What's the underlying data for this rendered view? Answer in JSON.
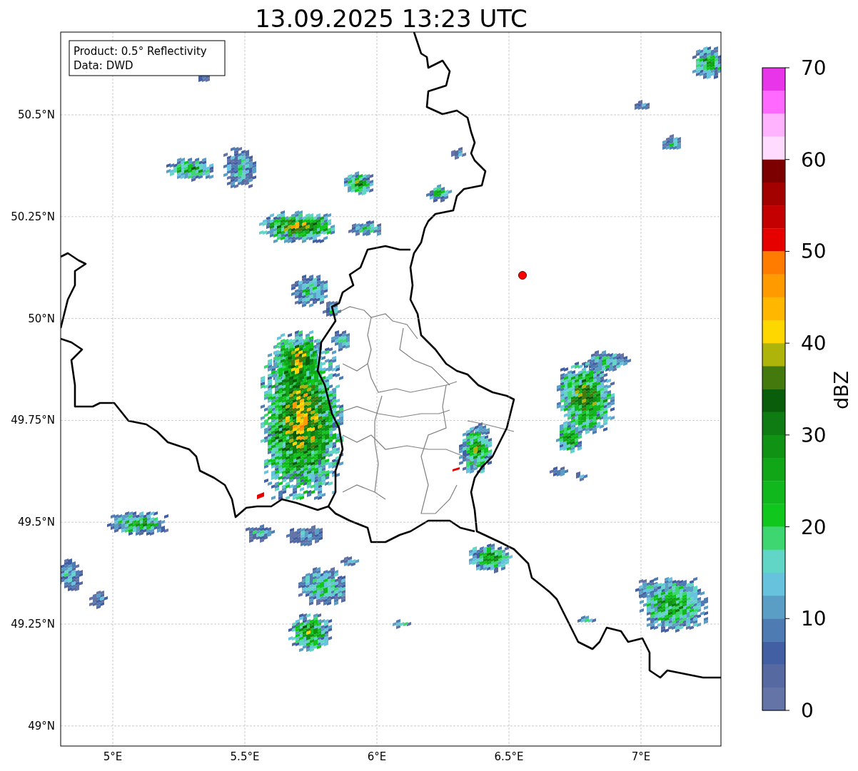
{
  "title": "13.09.2025 13:23 UTC",
  "legend": [
    "Product: 0.5° Reflectivity",
    "Data: DWD"
  ],
  "map": {
    "lat_ticks": [
      "50.5°N",
      "50.25°N",
      "50°N",
      "49.75°N",
      "49.5°N",
      "49.25°N",
      "49°N"
    ],
    "lon_ticks": [
      "5°E",
      "5.5°E",
      "6°E",
      "6.5°E",
      "7°E"
    ]
  },
  "colorbar": {
    "label": "dBZ",
    "ticks": [
      "70",
      "60",
      "50",
      "40",
      "30",
      "20",
      "10",
      "0"
    ],
    "bins": [
      {
        "color": "#e935e9"
      },
      {
        "color": "#ff69ff"
      },
      {
        "color": "#ffb3ff"
      },
      {
        "color": "#ffdcff"
      },
      {
        "color": "#7d0000"
      },
      {
        "color": "#a30000"
      },
      {
        "color": "#c40000"
      },
      {
        "color": "#e60000"
      },
      {
        "color": "#ff7c00"
      },
      {
        "color": "#ff9b00"
      },
      {
        "color": "#ffb700"
      },
      {
        "color": "#ffd700"
      },
      {
        "color": "#aeb40a"
      },
      {
        "color": "#447a0d"
      },
      {
        "color": "#0a5e0b"
      },
      {
        "color": "#0e7c12"
      },
      {
        "color": "#109214"
      },
      {
        "color": "#11a518"
      },
      {
        "color": "#10b81d"
      },
      {
        "color": "#10c81d"
      },
      {
        "color": "#3dd670"
      },
      {
        "color": "#61d6c6"
      },
      {
        "color": "#67c3dd"
      },
      {
        "color": "#5a9dc5"
      },
      {
        "color": "#4d7bb2"
      },
      {
        "color": "#435fa3"
      },
      {
        "color": "#5669a0"
      },
      {
        "color": "#6474a6"
      }
    ]
  }
}
